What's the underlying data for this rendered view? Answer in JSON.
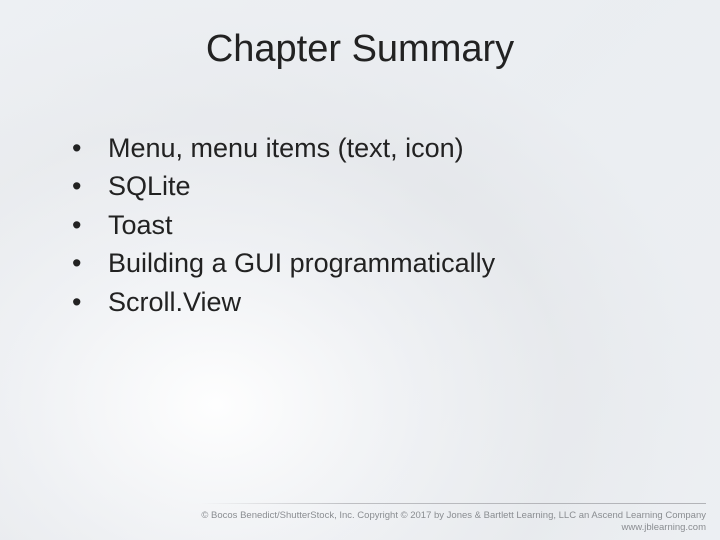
{
  "slide": {
    "title": "Chapter Summary",
    "bullets": [
      "Menu, menu items (text, icon)",
      "SQLite",
      "Toast",
      "Building a GUI programmatically",
      "Scroll.View"
    ],
    "footer": {
      "copyright": "© Bocos Benedict/ShutterStock, Inc. Copyright © 2017 by Jones & Bartlett Learning, LLC an Ascend Learning Company",
      "url": "www.jblearning.com"
    }
  }
}
